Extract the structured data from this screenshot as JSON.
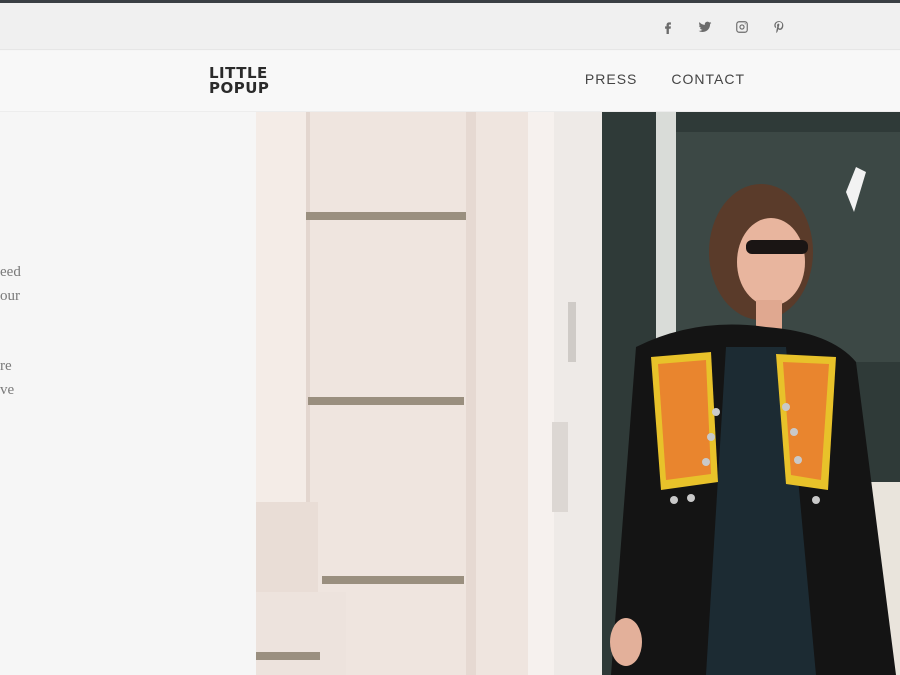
{
  "social": {
    "icons": [
      "facebook-icon",
      "twitter-icon",
      "instagram-icon",
      "pinterest-icon"
    ]
  },
  "logo": {
    "line1": "LITTLE",
    "line2": "POPUP"
  },
  "nav": {
    "items": [
      "PRESS",
      "CONTACT"
    ]
  },
  "left_text": {
    "fragments": [
      "eed",
      "our",
      "re",
      "ve"
    ]
  },
  "colors": {
    "accent_orange": "#e9852e",
    "accent_yellow": "#e8c22a",
    "text_gray": "#7a7a7a"
  }
}
